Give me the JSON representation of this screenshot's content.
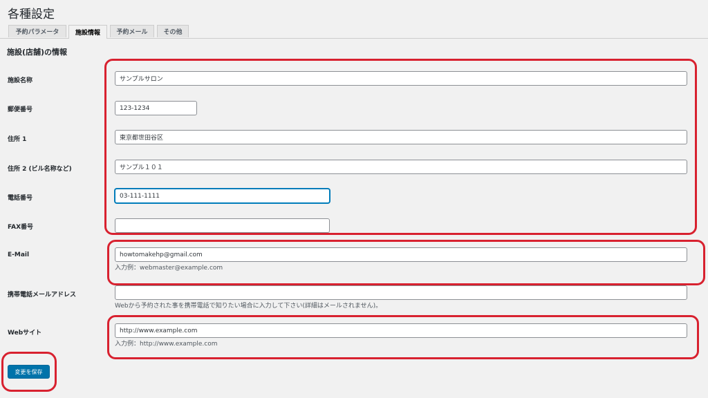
{
  "page_title": "各種設定",
  "tabs": [
    {
      "label": "予約パラメータ",
      "active": false
    },
    {
      "label": "施設情報",
      "active": true
    },
    {
      "label": "予約メール",
      "active": false
    },
    {
      "label": "その他",
      "active": false
    }
  ],
  "section_title": "施設(店舗)の情報",
  "fields": {
    "facility_name": {
      "label": "施設名称",
      "value": "サンプルサロン"
    },
    "postal_code": {
      "label": "郵便番号",
      "value": "123-1234"
    },
    "address1": {
      "label": "住所 1",
      "value": "東京都世田谷区"
    },
    "address2": {
      "label": "住所 2 (ビル名称など)",
      "value": "サンプル１０１"
    },
    "phone": {
      "label": "電話番号",
      "value": "03-111-1111"
    },
    "fax": {
      "label": "FAX番号",
      "value": ""
    },
    "email": {
      "label": "E-Mail",
      "value": "howtomakehp@gmail.com",
      "help": "入力例：webmaster@example.com"
    },
    "mobile_email": {
      "label": "携帯電話メールアドレス",
      "value": "",
      "help": "Webから予約された事を携帯電話で知りたい場合に入力して下さい(詳細はメールされません)。"
    },
    "website": {
      "label": "Webサイト",
      "value": "http://www.example.com",
      "help": "入力例：http://www.example.com"
    }
  },
  "save_button": "変更を保存",
  "colors": {
    "highlight": "#d8212f",
    "primary_button": "#0073aa",
    "focus": "#007cba",
    "background": "#f1f1f1"
  }
}
